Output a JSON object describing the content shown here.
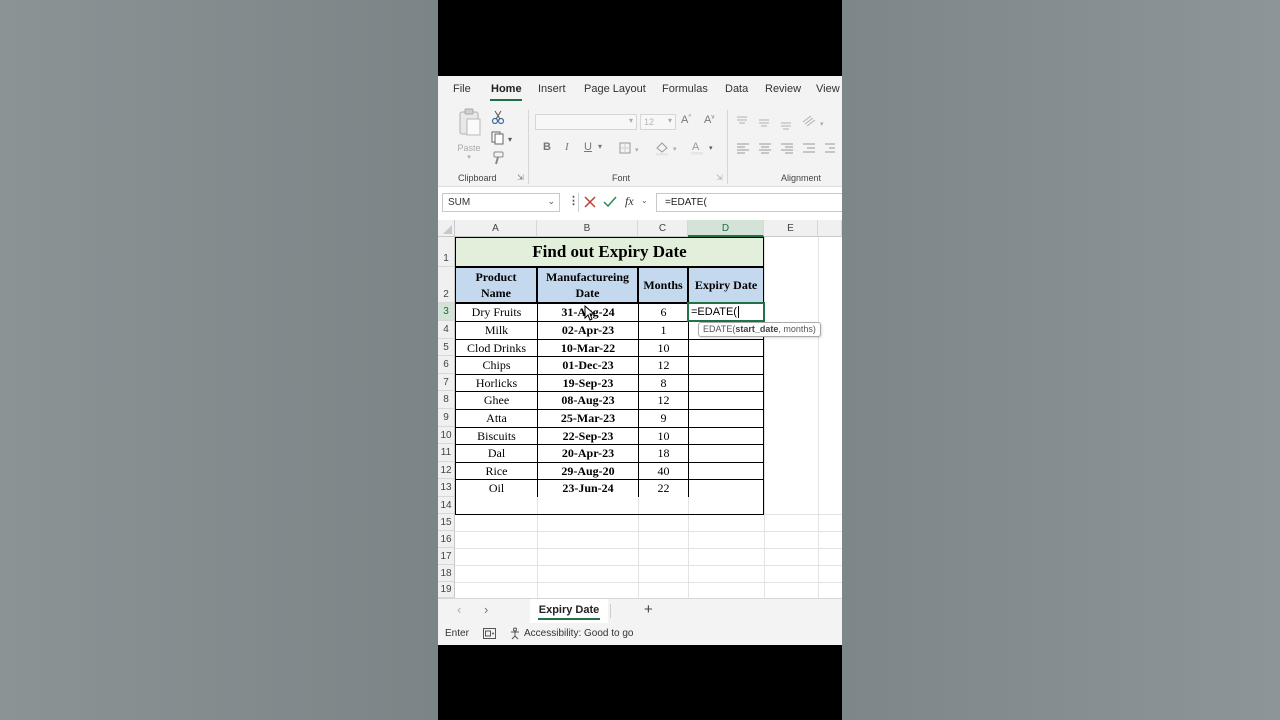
{
  "ribbon_tabs": [
    "File",
    "Home",
    "Insert",
    "Page Layout",
    "Formulas",
    "Data",
    "Review",
    "View"
  ],
  "ribbon": {
    "paste_label": "Paste",
    "font_size": "12",
    "bold": "B",
    "italic": "I",
    "underline": "U",
    "clipboard_label": "Clipboard",
    "font_label": "Font",
    "alignment_label": "Alignment"
  },
  "formula_bar": {
    "name_box": "SUM",
    "fx": "fx",
    "formula": "=EDATE("
  },
  "columns": [
    "A",
    "B",
    "C",
    "D",
    "E"
  ],
  "rows": [
    "1",
    "2",
    "3",
    "4",
    "5",
    "6",
    "7",
    "8",
    "9",
    "10",
    "11",
    "12",
    "13",
    "14",
    "15",
    "16",
    "17",
    "18",
    "19"
  ],
  "sheet": {
    "title": "Find out Expiry Date",
    "headers": {
      "product": "Product Name",
      "mfg": "Manufactureing Date",
      "months": "Months",
      "expiry": "Expiry Date"
    },
    "data": [
      {
        "product": "Dry Fruits",
        "mfg": "31-Aug-24",
        "months": "6"
      },
      {
        "product": "Milk",
        "mfg": "02-Apr-23",
        "months": "1"
      },
      {
        "product": "Clod Drinks",
        "mfg": "10-Mar-22",
        "months": "10"
      },
      {
        "product": "Chips",
        "mfg": "01-Dec-23",
        "months": "12"
      },
      {
        "product": "Horlicks",
        "mfg": "19-Sep-23",
        "months": "8"
      },
      {
        "product": "Ghee",
        "mfg": "08-Aug-23",
        "months": "12"
      },
      {
        "product": "Atta",
        "mfg": "25-Mar-23",
        "months": "9"
      },
      {
        "product": "Biscuits",
        "mfg": "22-Sep-23",
        "months": "10"
      },
      {
        "product": "Dal",
        "mfg": "20-Apr-23",
        "months": "18"
      },
      {
        "product": "Rice",
        "mfg": "29-Aug-20",
        "months": "40"
      },
      {
        "product": "Oil",
        "mfg": "23-Jun-24",
        "months": "22"
      }
    ],
    "active_cell_text": "=EDATE(",
    "tooltip": {
      "fn": "EDATE(",
      "arg1": "start_date",
      "rest": ", months)"
    }
  },
  "sheet_tabs": {
    "current": "Expiry Date",
    "add": "+"
  },
  "status": {
    "mode": "Enter",
    "accessibility": "Accessibility: Good to go"
  },
  "colors": {
    "accent": "#217346",
    "title_fill": "#e2efda",
    "header_fill": "#c5d9ee"
  }
}
